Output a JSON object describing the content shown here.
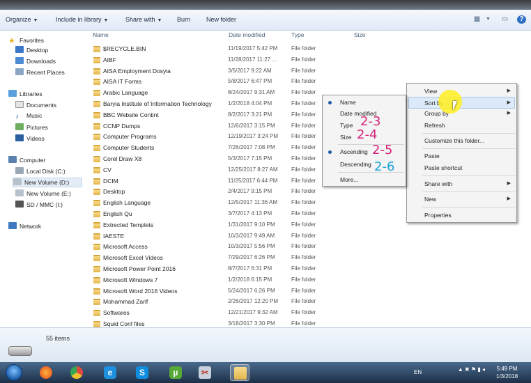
{
  "toolbar": {
    "organize": "Organize",
    "include": "Include in library",
    "share": "Share with",
    "burn": "Burn",
    "newfolder": "New folder"
  },
  "nav": {
    "favorites": "Favorites",
    "desktop": "Desktop",
    "downloads": "Downloads",
    "recent": "Recent Places",
    "libraries": "Libraries",
    "documents": "Documents",
    "music": "Music",
    "pictures": "Pictures",
    "videos": "Videos",
    "computer": "Computer",
    "local_c": "Local Disk (C:)",
    "vol_d": "New Volume (D:)",
    "vol_e": "New Volume (E:)",
    "sd": "SD / MMC (I:)",
    "network": "Network"
  },
  "columns": {
    "name": "Name",
    "date": "Date modified",
    "type": "Type",
    "size": "Size"
  },
  "files": [
    {
      "name": "$RECYCLE.BIN",
      "date": "11/19/2017 5:42 PM",
      "type": "File folder"
    },
    {
      "name": "AIBF",
      "date": "11/28/2017 11:27 ...",
      "type": "File folder"
    },
    {
      "name": "AISA Employment Dosyia",
      "date": "3/5/2017 9:22 AM",
      "type": "File folder"
    },
    {
      "name": "AISA IT Forms",
      "date": "5/8/2017 6:47 PM",
      "type": "File folder"
    },
    {
      "name": "Arabic Language",
      "date": "8/24/2017 9:31 AM",
      "type": "File folder"
    },
    {
      "name": "Baryia Institute of Information Technology",
      "date": "1/2/2018 4:04 PM",
      "type": "File folder"
    },
    {
      "name": "BBC Website Contint",
      "date": "8/2/2017 3:21 PM",
      "type": "File folder"
    },
    {
      "name": "CCNP Dumps",
      "date": "12/6/2017 3:15 PM",
      "type": "File folder"
    },
    {
      "name": "Computer Programs",
      "date": "12/19/2017 3:24 PM",
      "type": "File folder"
    },
    {
      "name": "Computer Students",
      "date": "7/26/2017 7:08 PM",
      "type": "File folder"
    },
    {
      "name": "Corel Draw X8",
      "date": "5/3/2017 7:15 PM",
      "type": "File folder"
    },
    {
      "name": "CV",
      "date": "12/25/2017 8:27 AM",
      "type": "File folder"
    },
    {
      "name": "DCIM",
      "date": "11/25/2017 6:44 PM",
      "type": "File folder"
    },
    {
      "name": "Desktop",
      "date": "2/4/2017 9:15 PM",
      "type": "File folder"
    },
    {
      "name": "English Language",
      "date": "12/5/2017 11:36 AM",
      "type": "File folder"
    },
    {
      "name": "English Qu",
      "date": "3/7/2017 4:13 PM",
      "type": "File folder"
    },
    {
      "name": "Extrected Templets",
      "date": "1/31/2017 9:10 PM",
      "type": "File folder"
    },
    {
      "name": "IAESTE",
      "date": "10/3/2017 9:49 AM",
      "type": "File folder"
    },
    {
      "name": "Microsoft Access",
      "date": "10/3/2017 5:56 PM",
      "type": "File folder"
    },
    {
      "name": "Microsoft Excel Videos",
      "date": "7/29/2017 6:26 PM",
      "type": "File folder"
    },
    {
      "name": "Microsoft Power Point 2016",
      "date": "8/7/2017 6:31 PM",
      "type": "File folder"
    },
    {
      "name": "Microsoft Windows 7",
      "date": "1/2/2018 6:15 PM",
      "type": "File folder"
    },
    {
      "name": "Microsoft Word 2016 Videos",
      "date": "5/24/2017 6:26 PM",
      "type": "File folder"
    },
    {
      "name": "Mohammad Zarif",
      "date": "2/26/2017 12:20 PM",
      "type": "File folder"
    },
    {
      "name": "Softwares",
      "date": "12/21/2017 9:32 AM",
      "type": "File folder"
    },
    {
      "name": "Squid Conf files",
      "date": "3/18/2017 3:30 PM",
      "type": "File folder"
    }
  ],
  "status": {
    "count": "55 items"
  },
  "context_menu": {
    "view": "View",
    "sortby": "Sort by",
    "groupby": "Group by",
    "refresh": "Refresh",
    "customize": "Customize this folder...",
    "paste": "Paste",
    "paste_shortcut": "Paste shortcut",
    "share": "Share with",
    "new": "New",
    "properties": "Properties"
  },
  "sort_menu": {
    "name": "Name",
    "date": "Date modified",
    "type": "Type",
    "size": "Size",
    "ascending": "Ascending",
    "descending": "Descending",
    "more": "More..."
  },
  "annotations": {
    "a1": "2-3",
    "a2": "2-4",
    "a3": "2-5",
    "a4": "2-6",
    "color_pink": "#d6247a",
    "color_cyan": "#1ba3d8"
  },
  "taskbar": {
    "lang": "EN",
    "time": "5:49 PM",
    "date": "1/3/2018"
  }
}
